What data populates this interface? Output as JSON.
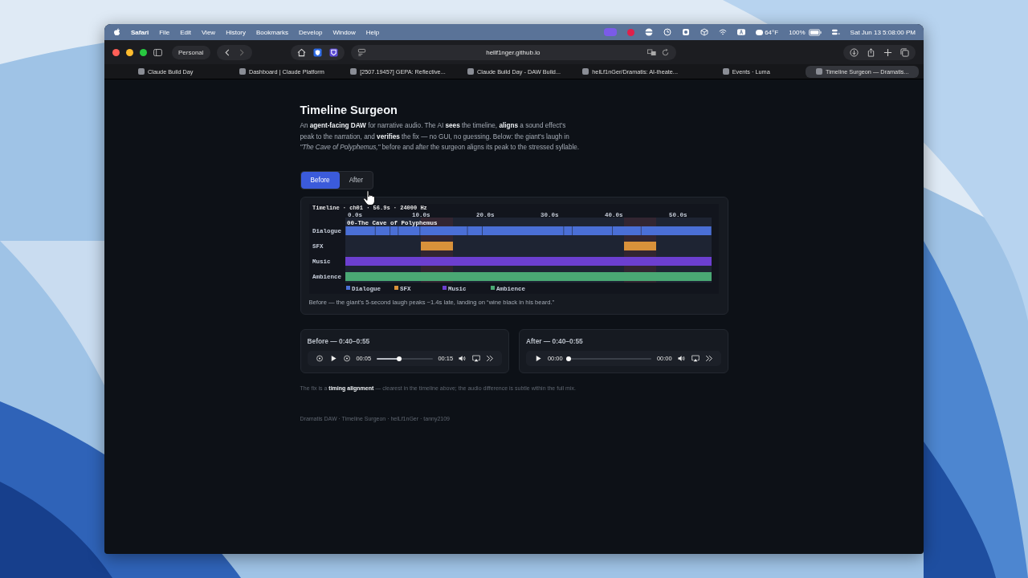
{
  "menu_bar": {
    "app": "Safari",
    "items": [
      "File",
      "Edit",
      "View",
      "History",
      "Bookmarks",
      "Develop",
      "Window",
      "Help"
    ],
    "weather": "64°F",
    "battery": "100%",
    "clock": "Sat Jun 13 5:08:00 PM"
  },
  "toolbar": {
    "profile": "Personal",
    "address": "hellf1nger.github.io"
  },
  "tabs": [
    {
      "title": "Claude Build Day",
      "selected": false
    },
    {
      "title": "Dashboard | Claude Platform",
      "selected": false
    },
    {
      "title": "[2507.19457] GEPA: Reflective...",
      "selected": false
    },
    {
      "title": "Claude Build Day - DAW Build...",
      "selected": false
    },
    {
      "title": "helLf1nGer/Dramatis: AI-theate...",
      "selected": false
    },
    {
      "title": "Events · Luma",
      "selected": false
    },
    {
      "title": "Timeline Surgeon — Dramatis...",
      "selected": true
    }
  ],
  "page": {
    "title": "Timeline Surgeon",
    "intro": "An **agent-facing DAW** for narrative audio. The AI **sees** the timeline, **aligns** a sound effect's peak to the narration, and **verifies** the fix — no GUI, no guessing. Below: the giant's laugh in *\"The Cave of Polyphemus,\"* before and after the surgeon aligns its peak to the stressed syllable.",
    "views": [
      {
        "label": "Before",
        "selected": true
      },
      {
        "label": "After",
        "selected": false
      }
    ],
    "timeline": {
      "header": "Timeline · ch01 · 56.9s · 24000 Hz",
      "ticks": [
        "0.0s",
        "10.0s",
        "20.0s",
        "30.0s",
        "40.0s",
        "50.0s"
      ],
      "scene": "00-The Cave of Polyphemus",
      "tracks": [
        {
          "name": "Dialogue",
          "kind": "dialogue",
          "color": "#4a6fd6"
        },
        {
          "name": "SFX",
          "kind": "sfx",
          "color": "#d9913a"
        },
        {
          "name": "Music",
          "kind": "bed",
          "color": "#6c3fd0"
        },
        {
          "name": "Ambience",
          "kind": "bed",
          "color": "#4aa874"
        }
      ],
      "legend": [
        {
          "label": "Dialogue",
          "color": "#4a6fd6"
        },
        {
          "label": "SFX",
          "color": "#d9913a"
        },
        {
          "label": "Music",
          "color": "#6c3fd0"
        },
        {
          "label": "Ambience",
          "color": "#4aa874"
        }
      ]
    },
    "caption": "Before — the giant's 5-second laugh peaks ~1.4s late, landing on “wine black in his beard.”",
    "players": [
      {
        "title": "Before — 0:40–0:55",
        "kind": "skip",
        "current": "00:05",
        "level": 0.4,
        "duration": "00:15"
      },
      {
        "title": "After — 0:40–0:55",
        "kind": "plain",
        "current": "00:00",
        "level": 0,
        "duration": "00:00"
      }
    ],
    "note": "The fix is a **timing alignment** — clearest in the timeline above; the audio difference is subtle within the full mix.",
    "footer": "Dramatis DAW · Timeline Surgeon · helLf1nGer · tanny2109"
  }
}
